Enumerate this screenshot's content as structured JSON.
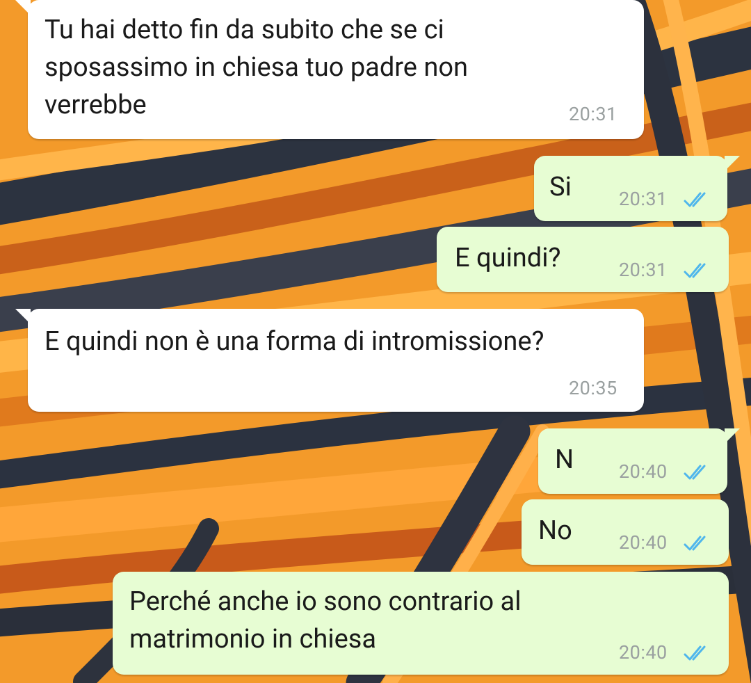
{
  "chat": {
    "messages": [
      {
        "direction": "in",
        "text": "Tu hai detto fin da subito che se ci sposassimo in chiesa tuo padre non verrebbe",
        "time": "20:31"
      },
      {
        "direction": "out",
        "text": "Si",
        "time": "20:31",
        "status": "read"
      },
      {
        "direction": "out",
        "text": "E quindi?",
        "time": "20:31",
        "status": "read"
      },
      {
        "direction": "in",
        "text": "E quindi non è una forma di intromissione?",
        "time": "20:35"
      },
      {
        "direction": "out",
        "text": "N",
        "time": "20:40",
        "status": "read"
      },
      {
        "direction": "out",
        "text": "No",
        "time": "20:40",
        "status": "read"
      },
      {
        "direction": "out",
        "text": "Perché anche io sono contrario al matrimonio in chiesa",
        "time": "20:40",
        "status": "read"
      }
    ]
  },
  "icons": {
    "read_receipt": "double-check-icon"
  },
  "colors": {
    "incoming_bubble": "#ffffff",
    "outgoing_bubble": "#e7fdd3",
    "read_ticks": "#4fb6ec",
    "timestamp": "#9aa0a0"
  }
}
